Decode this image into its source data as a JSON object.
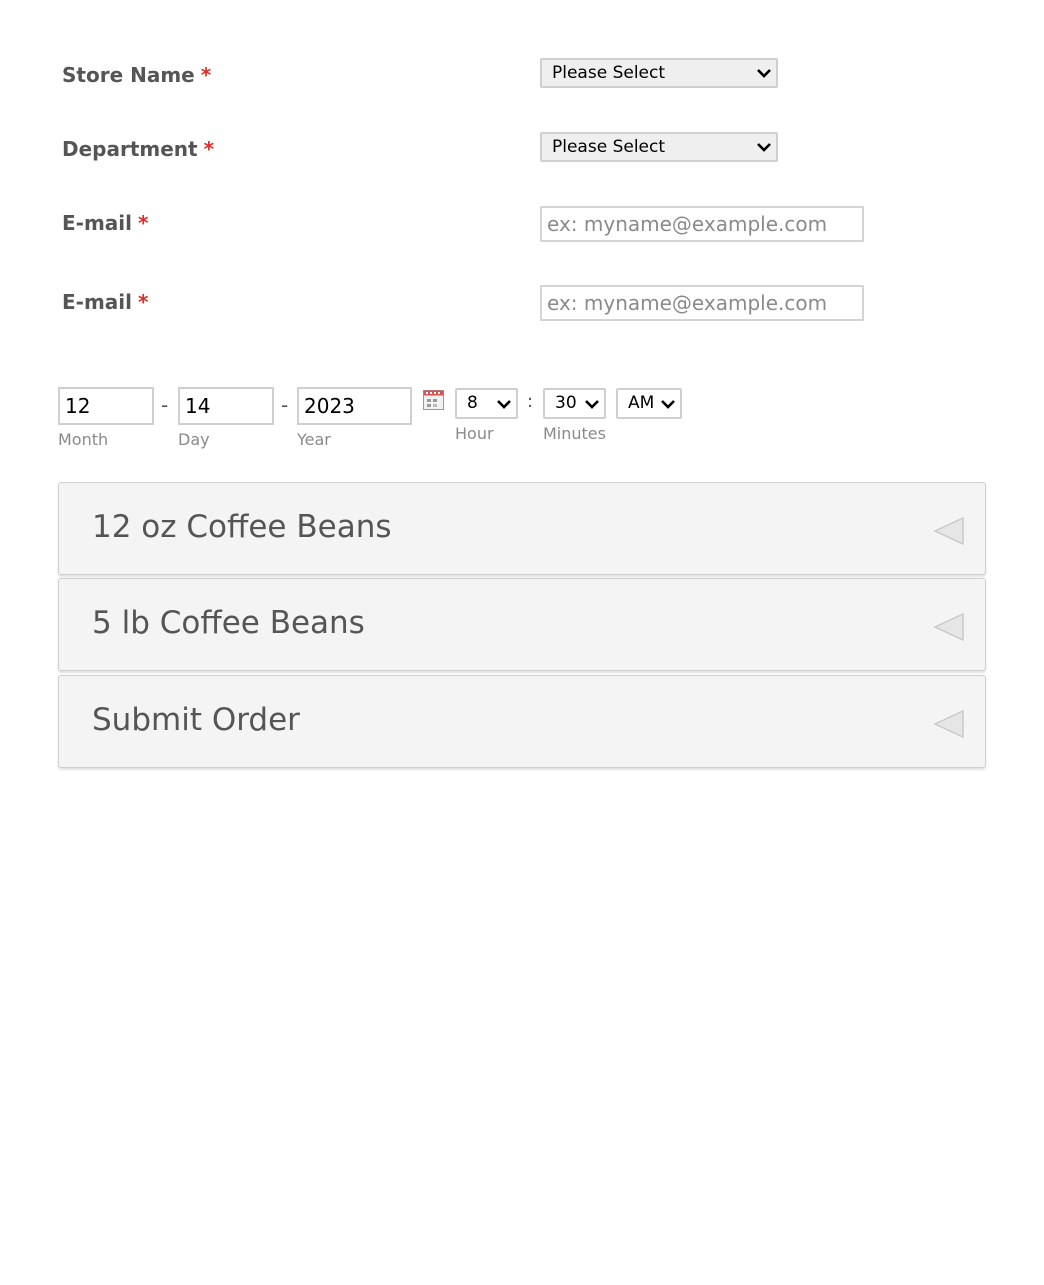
{
  "fields": {
    "store_name": {
      "label": "Store Name",
      "required_mark": "*",
      "value": "Please Select"
    },
    "department": {
      "label": "Department",
      "required_mark": "*",
      "value": "Please Select"
    },
    "email_1": {
      "label": "E-mail",
      "required_mark": "*",
      "placeholder": "ex: myname@example.com"
    },
    "email_2": {
      "label": "E-mail",
      "required_mark": "*",
      "placeholder": "ex: myname@example.com"
    }
  },
  "datetime": {
    "month": {
      "value": "12",
      "label": "Month"
    },
    "day": {
      "value": "14",
      "label": "Day"
    },
    "year": {
      "value": "2023",
      "label": "Year"
    },
    "separator": "-",
    "hour": {
      "value": "8",
      "label": "Hour"
    },
    "minutes": {
      "value": "30",
      "label": "Minutes"
    },
    "time_separator": ":",
    "ampm": {
      "value": "AM"
    },
    "calendar_icon": "calendar-icon"
  },
  "sections": [
    {
      "title": "12 oz Coffee Beans",
      "icon": "collapse-arrow-icon"
    },
    {
      "title": "5 lb Coffee Beans",
      "icon": "collapse-arrow-icon"
    },
    {
      "title": "Submit Order",
      "icon": "collapse-arrow-icon"
    }
  ],
  "colors": {
    "required": "#e02b27",
    "label_text": "#555555",
    "section_bg": "#f4f4f4",
    "border": "#cfcfcf"
  }
}
